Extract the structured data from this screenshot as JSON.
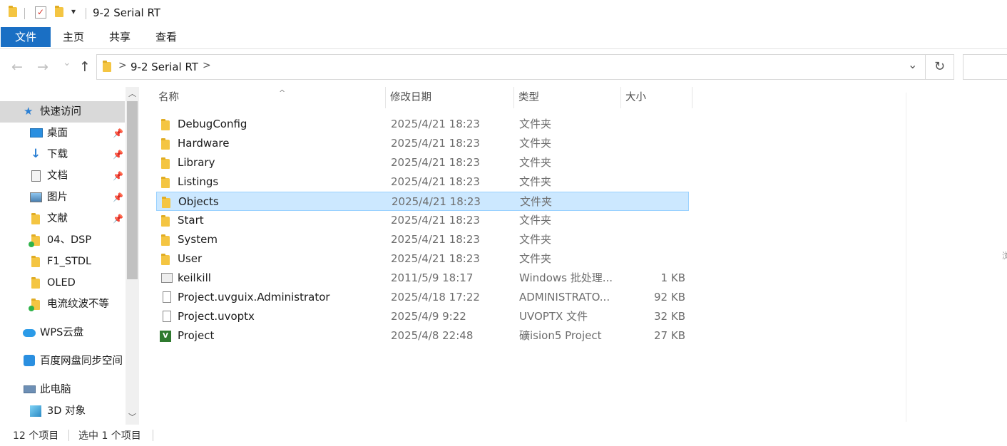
{
  "window": {
    "title": "9-2 Serial RT",
    "qat_dropdown": "▾"
  },
  "ribbon": {
    "tabs": [
      "文件",
      "主页",
      "共享",
      "查看"
    ]
  },
  "nav": {
    "back": "←",
    "forward": "→",
    "recent": "⌄",
    "up": "↑",
    "chevron": ">",
    "path": "9-2 Serial RT",
    "dropdown": "⌄",
    "refresh": "↻"
  },
  "sidebar": {
    "items": [
      {
        "label": "快速访问",
        "icon": "star-icon",
        "pinned": false
      },
      {
        "label": "桌面",
        "icon": "desktop-icon",
        "pinned": true
      },
      {
        "label": "下载",
        "icon": "download-icon",
        "pinned": true
      },
      {
        "label": "文档",
        "icon": "document-icon",
        "pinned": true
      },
      {
        "label": "图片",
        "icon": "picture-icon",
        "pinned": true
      },
      {
        "label": "文献",
        "icon": "folder-icon",
        "pinned": true
      },
      {
        "label": "04、DSP",
        "icon": "folder-sync-icon",
        "pinned": false
      },
      {
        "label": "F1_STDL",
        "icon": "folder-icon",
        "pinned": false
      },
      {
        "label": "OLED",
        "icon": "folder-icon",
        "pinned": false
      },
      {
        "label": "电流纹波不等",
        "icon": "folder-sync-icon",
        "pinned": false
      },
      {
        "label": "WPS云盘",
        "icon": "cloud-icon",
        "pinned": false
      },
      {
        "label": "百度网盘同步空间",
        "icon": "baidu-icon",
        "pinned": false
      },
      {
        "label": "此电脑",
        "icon": "computer-icon",
        "pinned": false
      },
      {
        "label": "3D 对象",
        "icon": "cube-icon",
        "pinned": false
      }
    ],
    "pin_glyph": "📌",
    "scroll_up": "︿",
    "scroll_down": "﹀"
  },
  "columns": {
    "name": "名称",
    "date": "修改日期",
    "type": "类型",
    "size": "大小",
    "sort_glyph": "^"
  },
  "files": [
    {
      "name": "DebugConfig",
      "date": "2025/4/21 18:23",
      "type": "文件夹",
      "size": "",
      "icon": "folder-icon"
    },
    {
      "name": "Hardware",
      "date": "2025/4/21 18:23",
      "type": "文件夹",
      "size": "",
      "icon": "folder-icon"
    },
    {
      "name": "Library",
      "date": "2025/4/21 18:23",
      "type": "文件夹",
      "size": "",
      "icon": "folder-icon"
    },
    {
      "name": "Listings",
      "date": "2025/4/21 18:23",
      "type": "文件夹",
      "size": "",
      "icon": "folder-icon"
    },
    {
      "name": "Objects",
      "date": "2025/4/21 18:23",
      "type": "文件夹",
      "size": "",
      "icon": "folder-icon",
      "selected": true
    },
    {
      "name": "Start",
      "date": "2025/4/21 18:23",
      "type": "文件夹",
      "size": "",
      "icon": "folder-icon"
    },
    {
      "name": "System",
      "date": "2025/4/21 18:23",
      "type": "文件夹",
      "size": "",
      "icon": "folder-icon"
    },
    {
      "name": "User",
      "date": "2025/4/21 18:23",
      "type": "文件夹",
      "size": "",
      "icon": "folder-icon"
    },
    {
      "name": "keilkill",
      "date": "2011/5/9 18:17",
      "type": "Windows 批处理...",
      "size": "1 KB",
      "icon": "batch-file-icon"
    },
    {
      "name": "Project.uvguix.Administrator",
      "date": "2025/4/18 17:22",
      "type": "ADMINISTRATO...",
      "size": "92 KB",
      "icon": "file-icon"
    },
    {
      "name": "Project.uvoptx",
      "date": "2025/4/9 9:22",
      "type": "UVOPTX 文件",
      "size": "32 KB",
      "icon": "file-icon"
    },
    {
      "name": "Project",
      "date": "2025/4/8 22:48",
      "type": "礦ision5 Project",
      "size": "27 KB",
      "icon": "uvision-project-icon"
    }
  ],
  "right_edge_glyph": "浏",
  "status": {
    "count": "12 个项目",
    "selection": "选中 1 个项目"
  },
  "colors": {
    "accent": "#1a6fc4",
    "selection_bg": "#cce8ff",
    "selection_border": "#99d1ff"
  }
}
